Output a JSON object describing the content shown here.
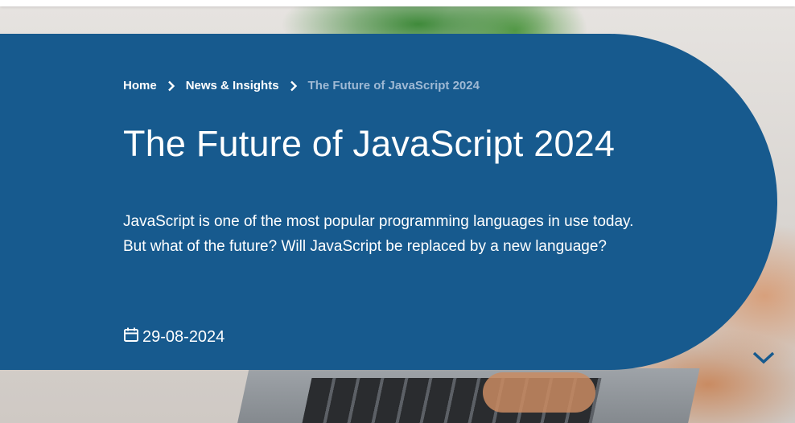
{
  "breadcrumb": {
    "items": [
      {
        "label": "Home"
      },
      {
        "label": "News & Insights"
      }
    ],
    "current": "The Future of JavaScript 2024"
  },
  "article": {
    "title": "The Future of JavaScript 2024",
    "lead": "JavaScript is one of the most popular programming languages in use today. But what of the future? Will JavaScript be replaced by a new language?",
    "date": "29-08-2024"
  },
  "icons": {
    "separator": "chevron-right-icon",
    "date": "calendar-icon",
    "scroll": "chevron-down-icon"
  },
  "colors": {
    "panel": "#175a8e",
    "breadcrumb_current": "#9fb9d4",
    "text": "#ffffff"
  }
}
